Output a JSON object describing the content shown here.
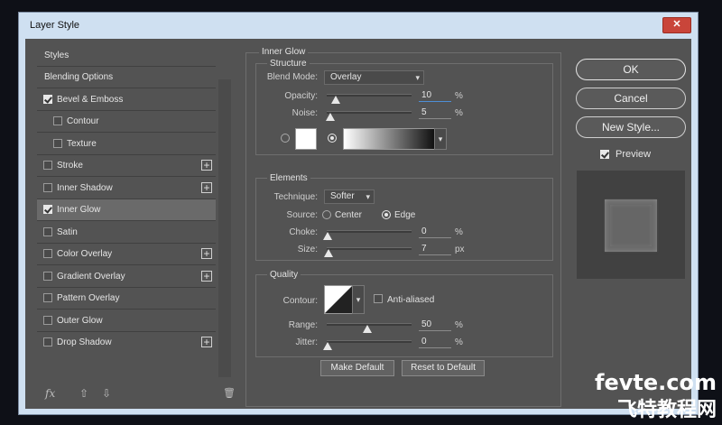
{
  "window": {
    "title": "Layer Style",
    "close_label": "✕"
  },
  "styles_list": {
    "header": "Styles",
    "blending_options": "Blending Options",
    "items": [
      {
        "label": "Bevel & Emboss",
        "checked": true
      },
      {
        "label": "Contour",
        "checked": false
      },
      {
        "label": "Texture",
        "checked": false
      },
      {
        "label": "Stroke",
        "checked": false
      },
      {
        "label": "Inner Shadow",
        "checked": false
      },
      {
        "label": "Inner Glow",
        "checked": true
      },
      {
        "label": "Satin",
        "checked": false
      },
      {
        "label": "Color Overlay",
        "checked": false
      },
      {
        "label": "Gradient Overlay",
        "checked": false
      },
      {
        "label": "Pattern Overlay",
        "checked": false
      },
      {
        "label": "Outer Glow",
        "checked": false
      },
      {
        "label": "Drop Shadow",
        "checked": false
      }
    ],
    "plus_symbol": "+",
    "fx_label": "fx",
    "up_symbol": "⇧",
    "down_symbol": "⇩",
    "trash_symbol": "🗑"
  },
  "inner_glow": {
    "title": "Inner Glow",
    "structure": {
      "title": "Structure",
      "blend_mode_label": "Blend Mode:",
      "blend_mode_value": "Overlay",
      "opacity_label": "Opacity:",
      "opacity_value": "10",
      "opacity_unit": "%",
      "noise_label": "Noise:",
      "noise_value": "5",
      "noise_unit": "%"
    },
    "elements": {
      "title": "Elements",
      "technique_label": "Technique:",
      "technique_value": "Softer",
      "source_label": "Source:",
      "source_center": "Center",
      "source_edge": "Edge",
      "choke_label": "Choke:",
      "choke_value": "0",
      "choke_unit": "%",
      "size_label": "Size:",
      "size_value": "7",
      "size_unit": "px"
    },
    "quality": {
      "title": "Quality",
      "contour_label": "Contour:",
      "anti_aliased_label": "Anti-aliased",
      "range_label": "Range:",
      "range_value": "50",
      "range_unit": "%",
      "jitter_label": "Jitter:",
      "jitter_value": "0",
      "jitter_unit": "%"
    },
    "make_default": "Make Default",
    "reset_default": "Reset to Default"
  },
  "actions": {
    "ok": "OK",
    "cancel": "Cancel",
    "new_style": "New Style...",
    "preview_label": "Preview"
  },
  "watermark": {
    "line1": "fevte.com",
    "line2": "飞特教程网"
  }
}
